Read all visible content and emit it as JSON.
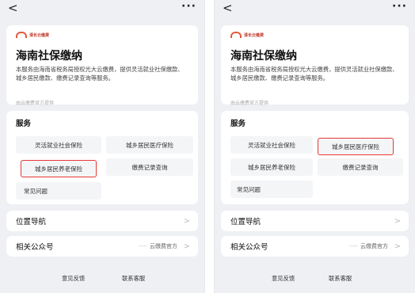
{
  "header": {
    "back_icon": "<",
    "more_icon": "···"
  },
  "service": {
    "logo_text": "清长云缴费",
    "title": "海南社保缴纳",
    "description": "本服务由海南省税务局授权光大云缴费，提供灵活就业社保缴款、城乡居民缴款、缴费记录查询等服务。",
    "provider": "由云缴费官方提供"
  },
  "services_section": {
    "title": "服务",
    "items": [
      {
        "label": "灵活就业社会保险"
      },
      {
        "label": "城乡居民医疗保险"
      },
      {
        "label": "城乡居民养老保险"
      },
      {
        "label": "缴费记录查询"
      },
      {
        "label": "常见问题"
      }
    ]
  },
  "location_nav": {
    "label": "位置导航",
    "chevron": ">"
  },
  "official_account": {
    "label": "相关公众号",
    "dots": "·····",
    "value": "云缴费官方",
    "chevron": ">"
  },
  "footer": {
    "feedback": "意见反馈",
    "contact": "联系客服"
  },
  "highlight_color": "#e53935"
}
